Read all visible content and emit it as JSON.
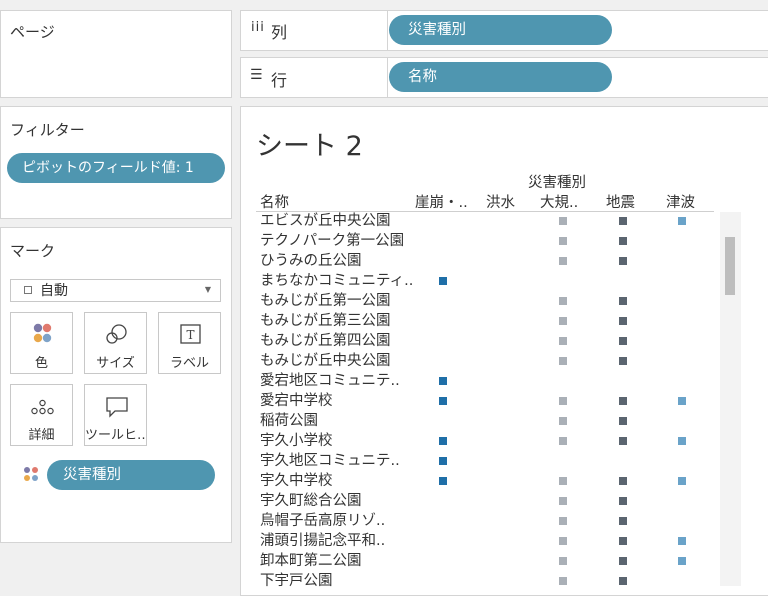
{
  "pages_panel": {
    "title": "ページ"
  },
  "filters_panel": {
    "title": "フィルター",
    "pill": "ピボットのフィールド値: 1"
  },
  "marks_panel": {
    "title": "マーク",
    "mark_type": "自動",
    "buttons": {
      "color": "色",
      "size": "サイズ",
      "label": "ラベル",
      "detail": "詳細",
      "tooltip": "ツールヒ…"
    },
    "color_field": "災害種別"
  },
  "shelves": {
    "columns": {
      "label": "列",
      "pill": "災害種別"
    },
    "rows": {
      "label": "行",
      "pill": "名称"
    }
  },
  "sheet": {
    "title": "シート 2",
    "column_group_header": "災害種別",
    "row_header": "名称",
    "columns": [
      "崖崩・..",
      "洪水",
      "大規..",
      "地震",
      "津波"
    ]
  },
  "colors": {
    "pill": "#4f96b0",
    "col_崖崩": "#1f6fa8",
    "col_大規": "#aab0b7",
    "col_地震": "#5b6570",
    "col_津波": "#6aa3c9"
  },
  "chart_data": {
    "type": "table",
    "columns": [
      "崖崩・..",
      "洪水",
      "大規..",
      "地震",
      "津波"
    ],
    "rows": [
      {
        "name": "エビスが丘中央公園",
        "marks": [
          0,
          0,
          1,
          1,
          1
        ]
      },
      {
        "name": "テクノパーク第一公園",
        "marks": [
          0,
          0,
          1,
          1,
          0
        ]
      },
      {
        "name": "ひうみの丘公園",
        "marks": [
          0,
          0,
          1,
          1,
          0
        ]
      },
      {
        "name": "まちなかコミュニティ..",
        "marks": [
          1,
          0,
          0,
          0,
          0
        ]
      },
      {
        "name": "もみじが丘第一公園",
        "marks": [
          0,
          0,
          1,
          1,
          0
        ]
      },
      {
        "name": "もみじが丘第三公園",
        "marks": [
          0,
          0,
          1,
          1,
          0
        ]
      },
      {
        "name": "もみじが丘第四公園",
        "marks": [
          0,
          0,
          1,
          1,
          0
        ]
      },
      {
        "name": "もみじが丘中央公園",
        "marks": [
          0,
          0,
          1,
          1,
          0
        ]
      },
      {
        "name": "愛宕地区コミュニテ..",
        "marks": [
          1,
          0,
          0,
          0,
          0
        ]
      },
      {
        "name": "愛宕中学校",
        "marks": [
          1,
          0,
          1,
          1,
          1
        ]
      },
      {
        "name": "稲荷公園",
        "marks": [
          0,
          0,
          1,
          1,
          0
        ]
      },
      {
        "name": "宇久小学校",
        "marks": [
          1,
          0,
          1,
          1,
          1
        ]
      },
      {
        "name": "宇久地区コミュニテ..",
        "marks": [
          1,
          0,
          0,
          0,
          0
        ]
      },
      {
        "name": "宇久中学校",
        "marks": [
          1,
          0,
          1,
          1,
          1
        ]
      },
      {
        "name": "宇久町総合公園",
        "marks": [
          0,
          0,
          1,
          1,
          0
        ]
      },
      {
        "name": "烏帽子岳高原リゾ..",
        "marks": [
          0,
          0,
          1,
          1,
          0
        ]
      },
      {
        "name": "浦頭引揚記念平和..",
        "marks": [
          0,
          0,
          1,
          1,
          1
        ]
      },
      {
        "name": "卸本町第二公園",
        "marks": [
          0,
          0,
          1,
          1,
          1
        ]
      },
      {
        "name": "下宇戸公園",
        "marks": [
          0,
          0,
          1,
          1,
          0
        ]
      }
    ]
  }
}
